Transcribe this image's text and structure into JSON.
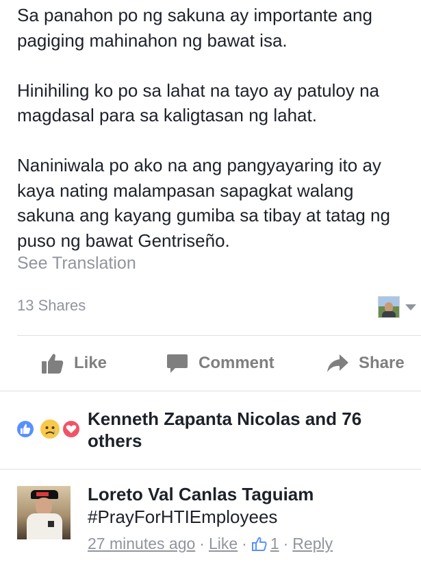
{
  "post": {
    "paragraphs": [
      "Sa panahon po ng sakuna ay importante ang pagiging mahinahon ng bawat isa.",
      "Hinihiling ko po sa lahat na tayo ay patuloy na magdasal para sa kaligtasan ng lahat.",
      "Naniniwala po ako na ang pangyayaring ito ay kaya nating malampasan sapagkat walang sakuna ang kayang gumiba sa tibay at tatag ng puso ng bawat Gentriseño."
    ],
    "see_translation": "See Translation",
    "shares": "13 Shares"
  },
  "actions": {
    "like": "Like",
    "comment": "Comment",
    "share": "Share"
  },
  "reactions": {
    "icons": [
      "like-reaction",
      "sad-reaction",
      "love-reaction"
    ],
    "summary": "Kenneth Zapanta Nicolas and 76 others"
  },
  "comment": {
    "author": "Loreto Val Canlas Taguiam",
    "text": "#PrayForHTIEmployees",
    "time": "27 minutes ago",
    "like_label": "Like",
    "like_count": "1",
    "reply_label": "Reply"
  },
  "colors": {
    "text": "#1d2129",
    "muted": "#90949c",
    "action": "#7f7f7f",
    "like_blue": "#5890ff",
    "love_red": "#f25268",
    "sad_yellow": "#f7c84b",
    "divider": "#dddfe2"
  }
}
